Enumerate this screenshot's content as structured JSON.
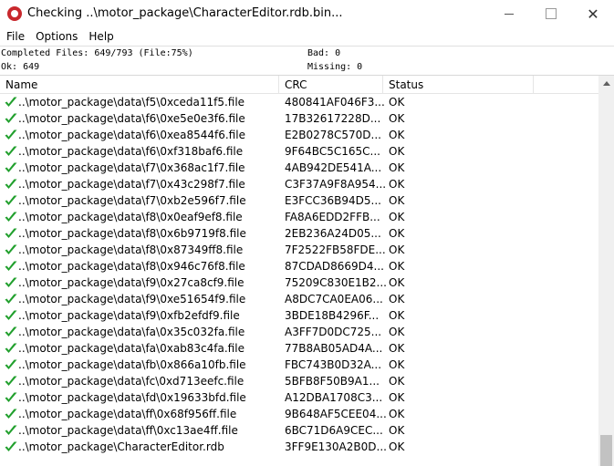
{
  "window": {
    "title": "Checking ..\\motor_package\\CharacterEditor.rdb.bin...",
    "close_glyph": "✕"
  },
  "menu": {
    "file": "File",
    "options": "Options",
    "help": "Help"
  },
  "summary": {
    "completed": "Completed Files: 649/793 (File:75%)",
    "bad": "Bad: 0",
    "ok": "Ok: 649",
    "missing": "Missing: 0"
  },
  "columns": {
    "name": "Name",
    "crc": "CRC",
    "status": "Status"
  },
  "check_color": "#22a02e",
  "rows": [
    {
      "name": "..\\motor_package\\data\\f5\\0xceda11f5.file",
      "crc": "480841AF046F3...",
      "status": "OK"
    },
    {
      "name": "..\\motor_package\\data\\f6\\0xe5e0e3f6.file",
      "crc": "17B32617228D...",
      "status": "OK"
    },
    {
      "name": "..\\motor_package\\data\\f6\\0xea8544f6.file",
      "crc": "E2B0278C570D...",
      "status": "OK"
    },
    {
      "name": "..\\motor_package\\data\\f6\\0xf318baf6.file",
      "crc": "9F64BC5C165C...",
      "status": "OK"
    },
    {
      "name": "..\\motor_package\\data\\f7\\0x368ac1f7.file",
      "crc": "4AB942DE541A...",
      "status": "OK"
    },
    {
      "name": "..\\motor_package\\data\\f7\\0x43c298f7.file",
      "crc": "C3F37A9F8A954...",
      "status": "OK"
    },
    {
      "name": "..\\motor_package\\data\\f7\\0xb2e596f7.file",
      "crc": "E3FCC36B94D5...",
      "status": "OK"
    },
    {
      "name": "..\\motor_package\\data\\f8\\0x0eaf9ef8.file",
      "crc": "FA8A6EDD2FFB...",
      "status": "OK"
    },
    {
      "name": "..\\motor_package\\data\\f8\\0x6b9719f8.file",
      "crc": "2EB236A24D05...",
      "status": "OK"
    },
    {
      "name": "..\\motor_package\\data\\f8\\0x87349ff8.file",
      "crc": "7F2522FB58FDE...",
      "status": "OK"
    },
    {
      "name": "..\\motor_package\\data\\f8\\0x946c76f8.file",
      "crc": "87CDAD8669D4...",
      "status": "OK"
    },
    {
      "name": "..\\motor_package\\data\\f9\\0x27ca8cf9.file",
      "crc": "75209C830E1B2...",
      "status": "OK"
    },
    {
      "name": "..\\motor_package\\data\\f9\\0xe51654f9.file",
      "crc": "A8DC7CA0EA06...",
      "status": "OK"
    },
    {
      "name": "..\\motor_package\\data\\f9\\0xfb2efdf9.file",
      "crc": "3BDE18B4296F...",
      "status": "OK"
    },
    {
      "name": "..\\motor_package\\data\\fa\\0x35c032fa.file",
      "crc": "A3FF7D0DC725...",
      "status": "OK"
    },
    {
      "name": "..\\motor_package\\data\\fa\\0xab83c4fa.file",
      "crc": "77B8AB05AD4A...",
      "status": "OK"
    },
    {
      "name": "..\\motor_package\\data\\fb\\0x866a10fb.file",
      "crc": "FBC743B0D32A...",
      "status": "OK"
    },
    {
      "name": "..\\motor_package\\data\\fc\\0xd713eefc.file",
      "crc": "5BFB8F50B9A1...",
      "status": "OK"
    },
    {
      "name": "..\\motor_package\\data\\fd\\0x19633bfd.file",
      "crc": "A12DBA1708C3...",
      "status": "OK"
    },
    {
      "name": "..\\motor_package\\data\\ff\\0x68f956ff.file",
      "crc": "9B648AF5CEE04...",
      "status": "OK"
    },
    {
      "name": "..\\motor_package\\data\\ff\\0xc13ae4ff.file",
      "crc": "6BC71D6A9CEC...",
      "status": "OK"
    },
    {
      "name": "..\\motor_package\\CharacterEditor.rdb",
      "crc": "3FF9E130A2B0D...",
      "status": "OK"
    }
  ]
}
